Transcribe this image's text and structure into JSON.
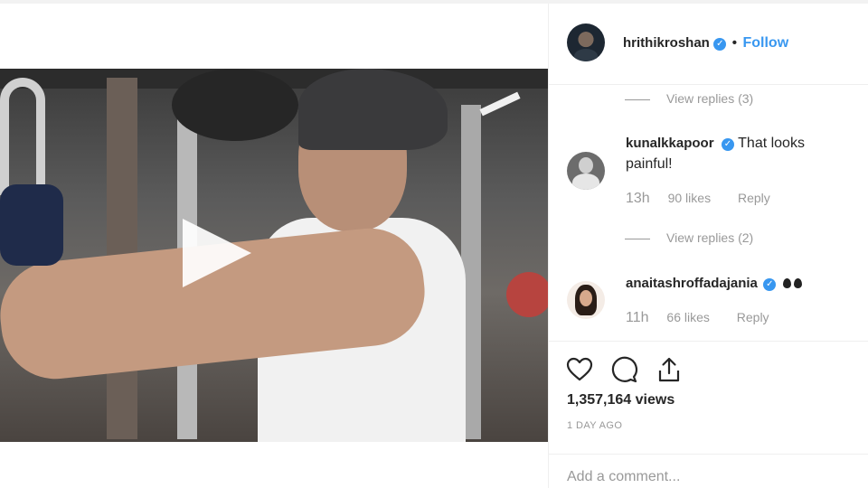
{
  "post": {
    "username": "hrithikroshan",
    "dot": "•",
    "follow_label": "Follow",
    "verified_mark": "✓"
  },
  "comments": [
    {
      "view_replies": "View replies (3)"
    },
    {
      "username": "kunalkkapoor",
      "text": "That looks painful!",
      "time": "13h",
      "likes": "90 likes",
      "reply": "Reply",
      "view_replies": "View replies (2)"
    },
    {
      "username": "anaitashroffadajania",
      "text": "",
      "time": "11h",
      "likes": "66 likes",
      "reply": "Reply",
      "emoji_count": 2
    }
  ],
  "actions": {
    "icons": [
      "heart-icon",
      "comment-icon",
      "share-icon"
    ]
  },
  "stats": {
    "views": "1,357,164 views",
    "time_ago": "1 DAY AGO"
  },
  "add_comment": {
    "placeholder": "Add a comment..."
  },
  "colors": {
    "accent": "#3897f0",
    "text": "#262626",
    "muted": "#999999"
  }
}
